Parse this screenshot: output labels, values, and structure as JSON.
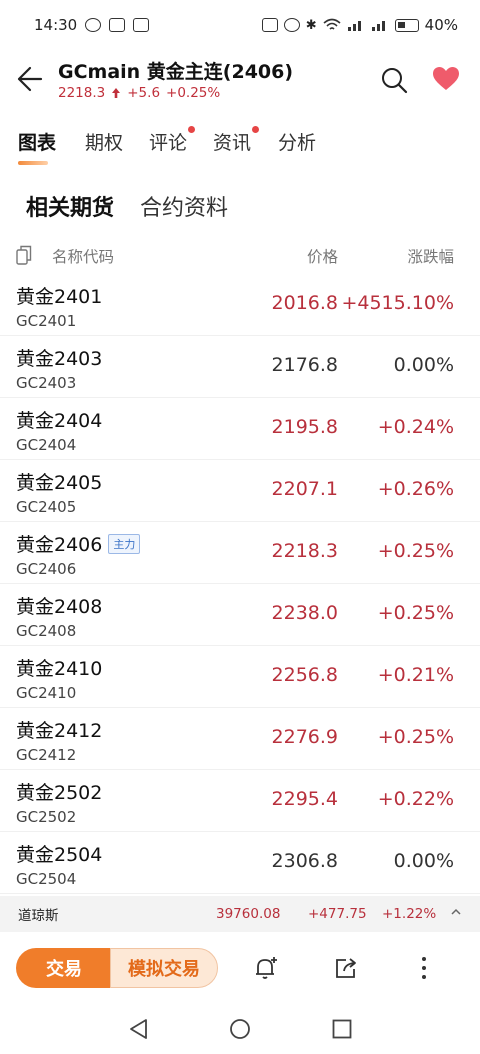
{
  "status_bar": {
    "time": "14:30",
    "battery": "40%"
  },
  "header": {
    "title": "GCmain  黄金主连(2406)",
    "price": "2218.3",
    "change": "+5.6",
    "change_pct": "+0.25%"
  },
  "tabs": [
    {
      "label": "图表",
      "active": true,
      "dot": false
    },
    {
      "label": "期权",
      "active": false,
      "dot": false
    },
    {
      "label": "评论",
      "active": false,
      "dot": true
    },
    {
      "label": "资讯",
      "active": false,
      "dot": true
    },
    {
      "label": "分析",
      "active": false,
      "dot": false
    }
  ],
  "subtabs": [
    {
      "label": "相关期货",
      "active": true
    },
    {
      "label": "合约资料",
      "active": false
    }
  ],
  "table": {
    "headers": {
      "name": "名称代码",
      "price": "价格",
      "change": "涨跌幅"
    },
    "rows": [
      {
        "name": "黄金2401",
        "code": "GC2401",
        "price": "2016.8",
        "change": "+4515.10%",
        "dir": "up",
        "badge": ""
      },
      {
        "name": "黄金2403",
        "code": "GC2403",
        "price": "2176.8",
        "change": "0.00%",
        "dir": "flat",
        "badge": ""
      },
      {
        "name": "黄金2404",
        "code": "GC2404",
        "price": "2195.8",
        "change": "+0.24%",
        "dir": "up",
        "badge": ""
      },
      {
        "name": "黄金2405",
        "code": "GC2405",
        "price": "2207.1",
        "change": "+0.26%",
        "dir": "up",
        "badge": ""
      },
      {
        "name": "黄金2406",
        "code": "GC2406",
        "price": "2218.3",
        "change": "+0.25%",
        "dir": "up",
        "badge": "主力"
      },
      {
        "name": "黄金2408",
        "code": "GC2408",
        "price": "2238.0",
        "change": "+0.25%",
        "dir": "up",
        "badge": ""
      },
      {
        "name": "黄金2410",
        "code": "GC2410",
        "price": "2256.8",
        "change": "+0.21%",
        "dir": "up",
        "badge": ""
      },
      {
        "name": "黄金2412",
        "code": "GC2412",
        "price": "2276.9",
        "change": "+0.25%",
        "dir": "up",
        "badge": ""
      },
      {
        "name": "黄金2502",
        "code": "GC2502",
        "price": "2295.4",
        "change": "+0.22%",
        "dir": "up",
        "badge": ""
      },
      {
        "name": "黄金2504",
        "code": "GC2504",
        "price": "2306.8",
        "change": "0.00%",
        "dir": "flat",
        "badge": ""
      }
    ]
  },
  "ticker": {
    "name": "道琼斯",
    "value": "39760.08",
    "change": "+477.75",
    "pct": "+1.22%"
  },
  "bottom": {
    "trade": "交易",
    "simulate": "模拟交易"
  },
  "colors": {
    "up": "#b8303c",
    "accent": "#f07d2a",
    "heart": "#ef5b6b"
  }
}
